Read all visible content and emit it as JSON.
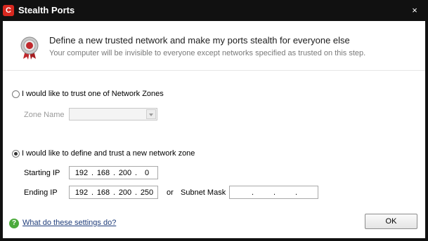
{
  "window": {
    "title": "Stealth Ports",
    "logo_text": "C",
    "close_glyph": "×"
  },
  "header": {
    "title": "Define a new trusted network and make my ports stealth for everyone else",
    "subtitle": "Your computer will be invisible to everyone except networks specified as trusted on this step.",
    "icon": "shield-ribbon-icon"
  },
  "option_zones": {
    "label": "I would like to trust one of Network Zones",
    "selected": false,
    "zone_name_label": "Zone Name",
    "zone_name_value": ""
  },
  "option_new_zone": {
    "label": "I would like to define and trust a new network zone",
    "selected": true,
    "starting_ip_label": "Starting IP",
    "starting_ip": [
      "192",
      "168",
      "200",
      "0"
    ],
    "ending_ip_label": "Ending IP",
    "ending_ip": [
      "192",
      "168",
      "200",
      "250"
    ],
    "or_label": "or",
    "subnet_mask_label": "Subnet Mask",
    "subnet_mask": [
      "",
      "",
      "",
      ""
    ]
  },
  "footer": {
    "help_label": "What do these settings do?",
    "ok_label": "OK"
  },
  "colors": {
    "titlebar": "#111111",
    "logo": "#d8281f",
    "help_icon": "#4caa3c",
    "link": "#1e3c7a"
  }
}
